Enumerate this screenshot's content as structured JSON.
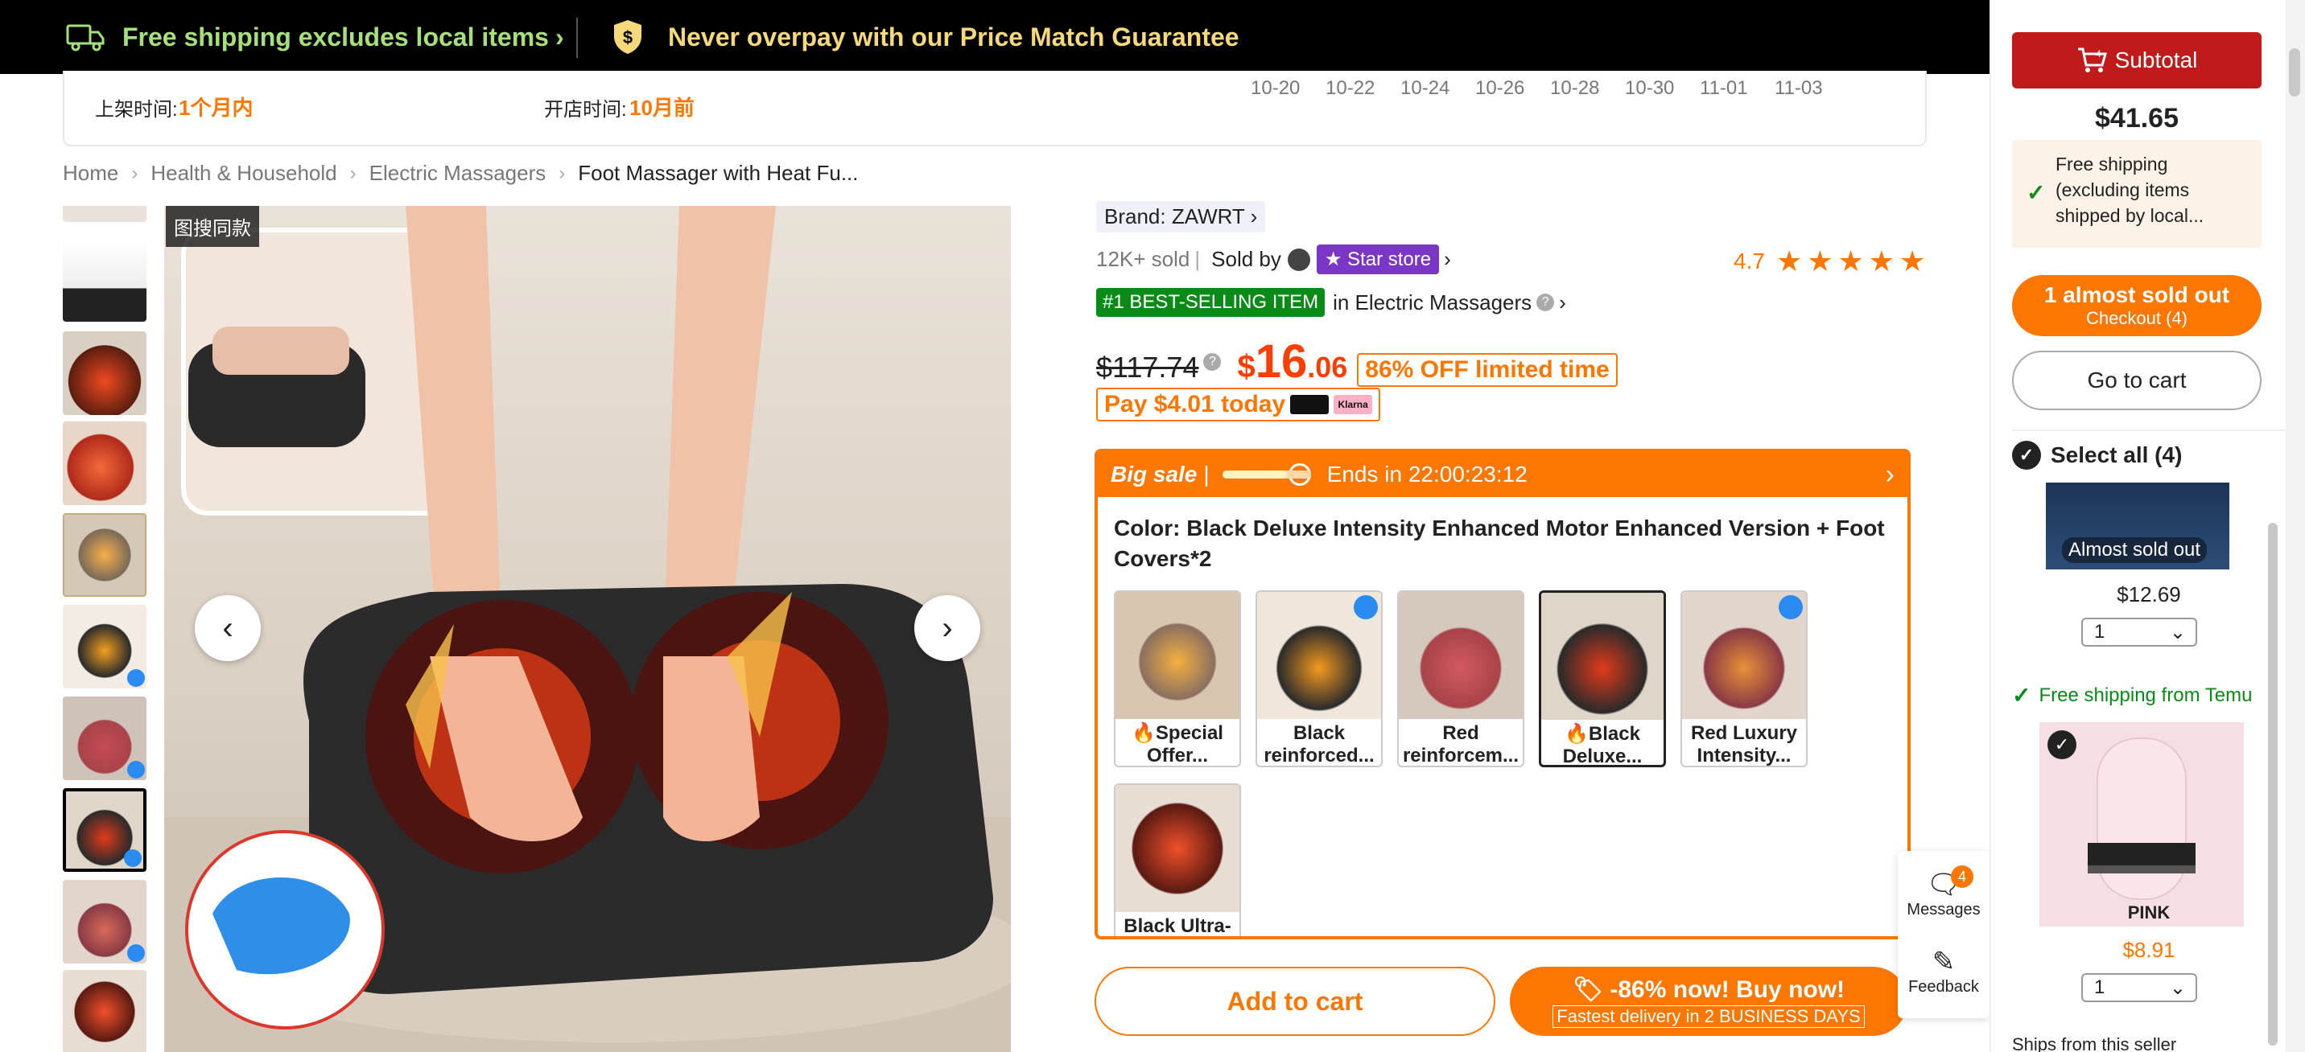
{
  "topbar": {
    "free_shipping": "Free shipping excludes local items",
    "price_match": "Never overpay with our Price Match Guarantee"
  },
  "stats": {
    "listed_label": "上架时间:",
    "listed_value": "1个月内",
    "store_label": "开店时间:",
    "store_value": "10月前",
    "dates": [
      "10-20",
      "10-22",
      "10-24",
      "10-26",
      "10-28",
      "10-30",
      "11-01",
      "11-03"
    ]
  },
  "breadcrumb": {
    "items": [
      "Home",
      "Health & Household",
      "Electric Massagers"
    ],
    "current": "Foot Massager with Heat Fu..."
  },
  "main_image": {
    "search_tag": "图搜同款"
  },
  "product": {
    "brand": "Brand: ZAWRT",
    "sold": "12K+ sold",
    "sold_by": "Sold by",
    "store_badge": "★ Star store",
    "rating": "4.7",
    "stars": "★★★★★",
    "best_selling": "#1 BEST-SELLING ITEM",
    "category": "in Electric Massagers",
    "old_price": "$117.74",
    "price_symbol": "$",
    "price_int": "16",
    "price_dec": ".06",
    "off_badge": "86% OFF limited time",
    "pay_today": "Pay $4.01 today",
    "pay_logo2": "Klarna"
  },
  "sale": {
    "title": "Big sale",
    "ends": "Ends in 22:00:23:12",
    "color_title": "Color: Black Deluxe Intensity Enhanced Motor Enhanced Version + Foot Covers*2",
    "options": [
      {
        "label1": "🔥Special",
        "label2": "Offer..."
      },
      {
        "label1": "Black",
        "label2": "reinforced..."
      },
      {
        "label1": "Red",
        "label2": "reinforcem..."
      },
      {
        "label1": "🔥Black",
        "label2": "Deluxe..."
      },
      {
        "label1": "Red Luxury",
        "label2": "Intensity..."
      },
      {
        "label1": "Black Ultra-",
        "label2": ""
      }
    ]
  },
  "actions": {
    "add_to_cart": "Add to cart",
    "buy_now": "🏷 -86% now! Buy now!",
    "fast_delivery": "Fastest delivery in 2 BUSINESS DAYS"
  },
  "float": {
    "messages": "Messages",
    "messages_count": "4",
    "feedback": "Feedback"
  },
  "cart": {
    "subtotal_label": "Subtotal",
    "subtotal_value": "$41.65",
    "free_shipping": "Free shipping (excluding items shipped by local...",
    "almost_sold": "1 almost sold out",
    "checkout": "Checkout (4)",
    "go_to_cart": "Go to cart",
    "select_all": "Select all (4)",
    "item1_badge": "Almost sold out",
    "item1_price": "$12.69",
    "item1_qty": "1",
    "free_shipping_temu": "Free shipping from Temu",
    "item2_name": "PINK",
    "item2_price": "$8.91",
    "item2_qty": "1",
    "ships_from": "Ships from this seller"
  }
}
